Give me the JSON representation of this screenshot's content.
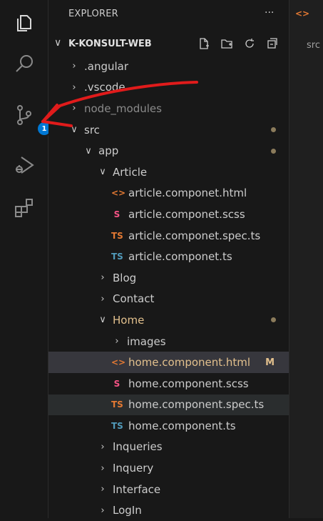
{
  "activity_bar": {
    "items": [
      {
        "icon": "files-icon"
      },
      {
        "icon": "search-icon"
      },
      {
        "icon": "source-control-icon",
        "badge": "1"
      },
      {
        "icon": "run-debug-icon"
      },
      {
        "icon": "extensions-icon"
      }
    ]
  },
  "sidebar": {
    "title": "EXPLORER",
    "more": "···",
    "project": {
      "chevron": "∨",
      "name": "K-KONSULT-WEB"
    },
    "tree": [
      {
        "depth": 0,
        "type": "folder",
        "open": false,
        "label": "angular",
        "prefix": "."
      },
      {
        "depth": 0,
        "type": "folder",
        "open": false,
        "label": ".vscode"
      },
      {
        "depth": 0,
        "type": "folder",
        "open": false,
        "label": "node_modules",
        "dim": true
      },
      {
        "depth": 0,
        "type": "folder",
        "open": true,
        "label": "src",
        "dot": true
      },
      {
        "depth": 1,
        "type": "folder",
        "open": true,
        "label": "app",
        "dot": true
      },
      {
        "depth": 2,
        "type": "folder",
        "open": true,
        "label": "Article"
      },
      {
        "depth": 3,
        "type": "file",
        "kind": "html",
        "label": "article.componet.html"
      },
      {
        "depth": 3,
        "type": "file",
        "kind": "scss",
        "label": "article.componet.scss"
      },
      {
        "depth": 3,
        "type": "file",
        "kind": "spec",
        "label": "article.componet.spec.ts"
      },
      {
        "depth": 3,
        "type": "file",
        "kind": "ts",
        "label": "article.componet.ts"
      },
      {
        "depth": 2,
        "type": "folder",
        "open": false,
        "label": "Blog"
      },
      {
        "depth": 2,
        "type": "folder",
        "open": false,
        "label": "Contact"
      },
      {
        "depth": 2,
        "type": "folder",
        "open": true,
        "label": "Home",
        "modified": true,
        "dot": true
      },
      {
        "depth": 3,
        "type": "folder",
        "open": false,
        "label": "images"
      },
      {
        "depth": 3,
        "type": "file",
        "kind": "html",
        "label": "home.component.html",
        "modified": true,
        "status": "M",
        "active": true
      },
      {
        "depth": 3,
        "type": "file",
        "kind": "scss",
        "label": "home.component.scss"
      },
      {
        "depth": 3,
        "type": "file",
        "kind": "spec",
        "label": "home.component.spec.ts",
        "hover": true
      },
      {
        "depth": 3,
        "type": "file",
        "kind": "ts",
        "label": "home.component.ts"
      },
      {
        "depth": 2,
        "type": "folder",
        "open": false,
        "label": "Inqueries"
      },
      {
        "depth": 2,
        "type": "folder",
        "open": false,
        "label": "Inquery"
      },
      {
        "depth": 2,
        "type": "folder",
        "open": false,
        "label": "Interface"
      },
      {
        "depth": 2,
        "type": "folder",
        "open": false,
        "label": "LogIn"
      }
    ]
  },
  "editor": {
    "tab_icon": "<>",
    "breadcrumb": "src"
  },
  "colors": {
    "html": "#e37933",
    "scss": "#f55385",
    "spec": "#e37933",
    "ts": "#519aba",
    "modified": "#e2c08d",
    "badge": "#0078d4",
    "annotation": "#e01b1b"
  }
}
